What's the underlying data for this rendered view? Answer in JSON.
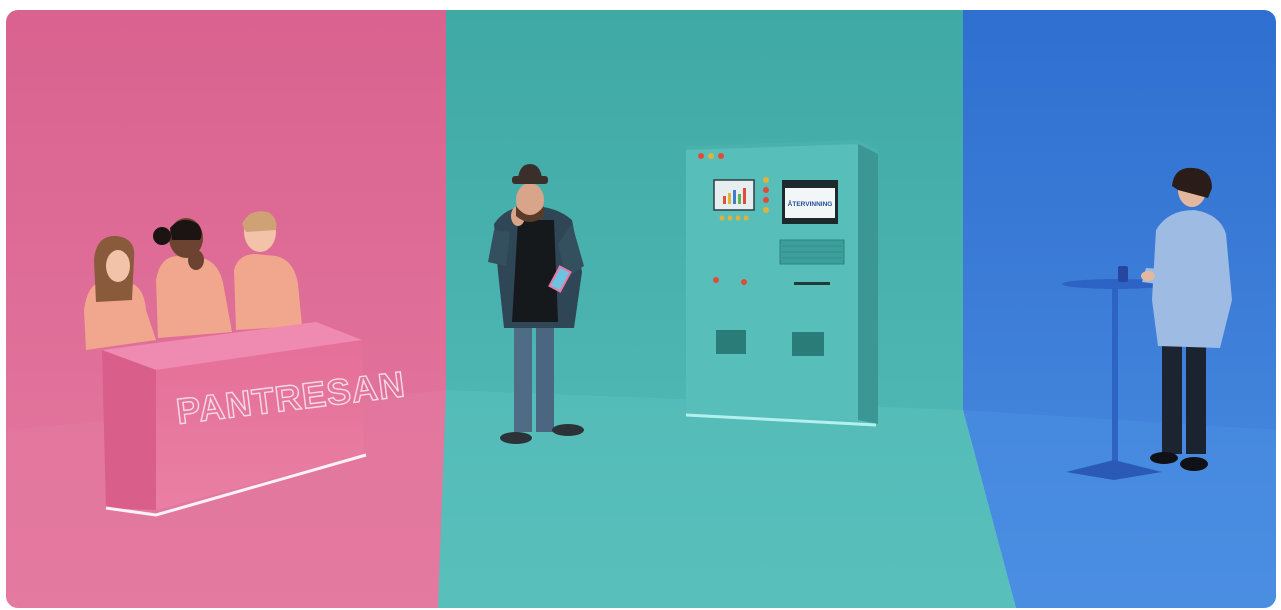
{
  "scene": {
    "podium_sign": "PANTRESAN",
    "machine_screen": "ÅTERVINNING"
  },
  "colors": {
    "pink_set": "#d96a92",
    "teal_set": "#48b3b0",
    "blue_set": "#3d7fd8",
    "machine": "#55bcb8",
    "podium": "#e57aa0"
  }
}
